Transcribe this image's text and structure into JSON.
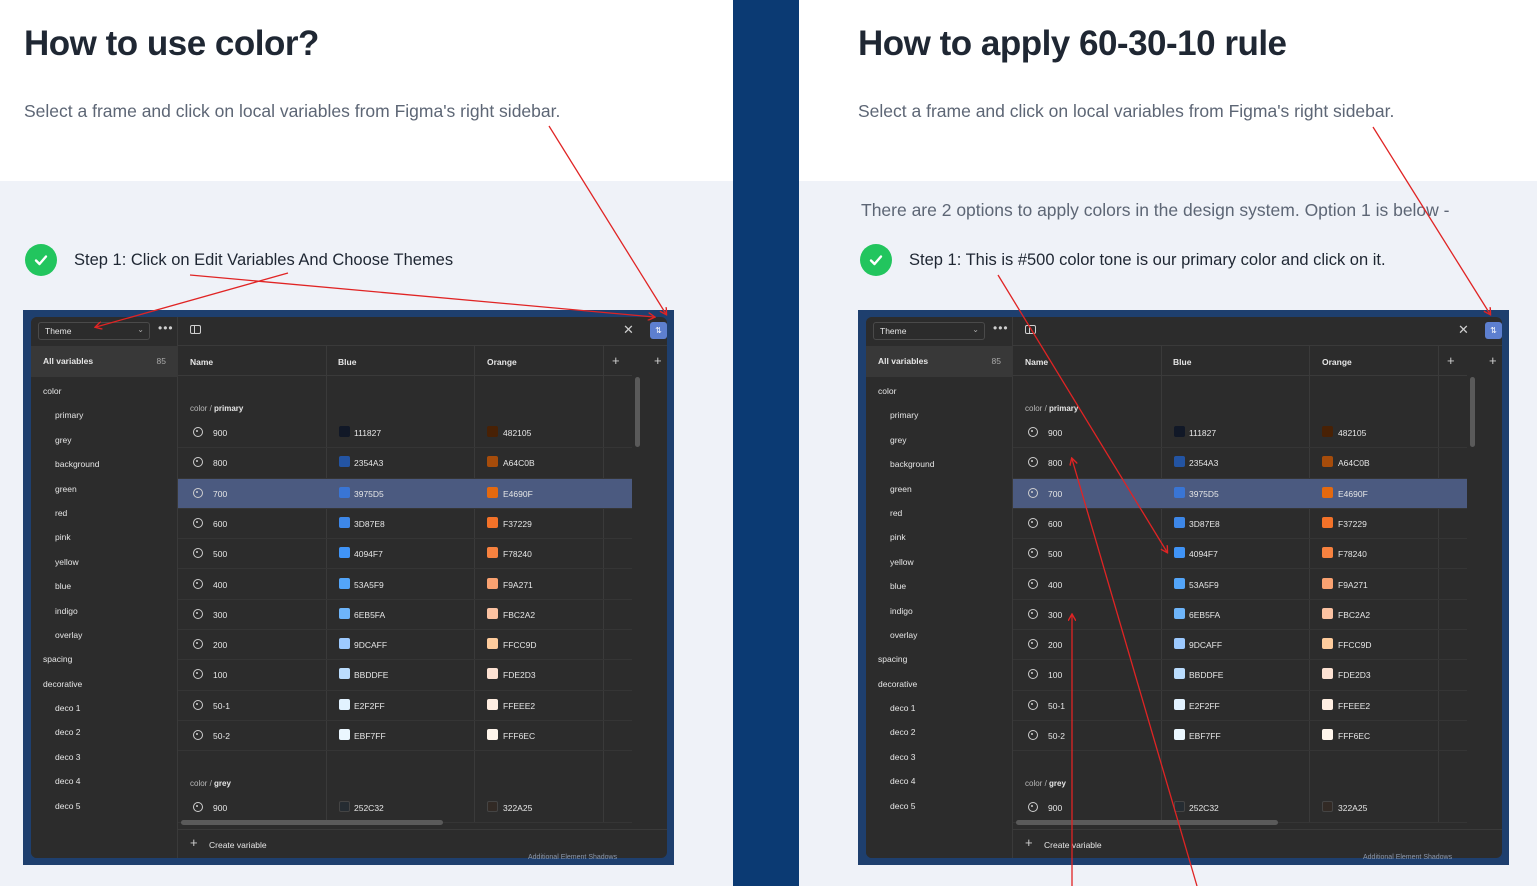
{
  "left": {
    "title": "How to use color?",
    "subtitle": "Select a frame and click on local variables from Figma's right sidebar.",
    "step": "Step 1: Click on Edit Variables And Choose Themes"
  },
  "right": {
    "title": "How to apply 60-30-10 rule",
    "subtitle": "Select a frame and click on local variables from Figma's right sidebar.",
    "options": "There are 2 options to apply colors in the design system. Option 1 is below -",
    "step": "Step 1: This is #500 color tone is our primary color and click on it."
  },
  "figma": {
    "theme_label": "Theme",
    "all_variables": "All variables",
    "count": "85",
    "nav": [
      {
        "label": "color",
        "level": 0
      },
      {
        "label": "primary",
        "level": 1
      },
      {
        "label": "grey",
        "level": 1
      },
      {
        "label": "background",
        "level": 1
      },
      {
        "label": "green",
        "level": 1
      },
      {
        "label": "red",
        "level": 1
      },
      {
        "label": "pink",
        "level": 1
      },
      {
        "label": "yellow",
        "level": 1
      },
      {
        "label": "blue",
        "level": 1
      },
      {
        "label": "indigo",
        "level": 1
      },
      {
        "label": "overlay",
        "level": 1
      },
      {
        "label": "spacing",
        "level": 0
      },
      {
        "label": "decorative",
        "level": 0
      },
      {
        "label": "deco 1",
        "level": 1
      },
      {
        "label": "deco 2",
        "level": 1
      },
      {
        "label": "deco 3",
        "level": 1
      },
      {
        "label": "deco 4",
        "level": 1
      },
      {
        "label": "deco 5",
        "level": 1
      }
    ],
    "columns": {
      "name": "Name",
      "blue": "Blue",
      "orange": "Orange"
    },
    "group_primary": {
      "prefix": "color / ",
      "name": "primary"
    },
    "group_grey": {
      "prefix": "color / ",
      "name": "grey"
    },
    "rows": [
      {
        "name": "900",
        "blue": "111827",
        "blue_color": "#111827",
        "orange": "482105",
        "orange_color": "#482105"
      },
      {
        "name": "800",
        "blue": "2354A3",
        "blue_color": "#2354A3",
        "orange": "A64C0B",
        "orange_color": "#A64C0B"
      },
      {
        "name": "700",
        "blue": "3975D5",
        "blue_color": "#3975D5",
        "orange": "E4690F",
        "orange_color": "#E4690F",
        "selected": true
      },
      {
        "name": "600",
        "blue": "3D87E8",
        "blue_color": "#3D87E8",
        "orange": "F37229",
        "orange_color": "#F37229"
      },
      {
        "name": "500",
        "blue": "4094F7",
        "blue_color": "#4094F7",
        "orange": "F78240",
        "orange_color": "#F78240"
      },
      {
        "name": "400",
        "blue": "53A5F9",
        "blue_color": "#53A5F9",
        "orange": "F9A271",
        "orange_color": "#F9A271"
      },
      {
        "name": "300",
        "blue": "6EB5FA",
        "blue_color": "#6EB5FA",
        "orange": "FBC2A2",
        "orange_color": "#FBC2A2"
      },
      {
        "name": "200",
        "blue": "9DCAFF",
        "blue_color": "#9DCAFF",
        "orange": "FFCC9D",
        "orange_color": "#FFCC9D"
      },
      {
        "name": "100",
        "blue": "BBDDFE",
        "blue_color": "#BBDDFE",
        "orange": "FDE2D3",
        "orange_color": "#FDE2D3"
      },
      {
        "name": "50-1",
        "blue": "E2F2FF",
        "blue_color": "#E2F2FF",
        "orange": "FFEEE2",
        "orange_color": "#FFEEE2"
      },
      {
        "name": "50-2",
        "blue": "EBF7FF",
        "blue_color": "#EBF7FF",
        "orange": "FFF6EC",
        "orange_color": "#FFF6EC"
      }
    ],
    "grey_row": {
      "name": "900",
      "blue": "252C32",
      "blue_color": "#252C32",
      "orange": "322A25",
      "orange_color": "#322A25"
    },
    "create_variable": "Create variable",
    "behind_text": "Additional Element Shadows"
  },
  "colors": {
    "divider": "#0b3a73",
    "check": "#22c55e",
    "arrow": "#e02424",
    "selected_row": "#4b5a80"
  }
}
